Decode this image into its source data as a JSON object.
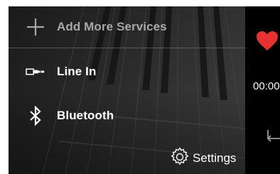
{
  "menu": {
    "add_services": {
      "label": "Add More Services",
      "icon": "plus-icon"
    },
    "line_in": {
      "label": "Line In",
      "icon": "line-in-jack-icon"
    },
    "bluetooth": {
      "label": "Bluetooth",
      "icon": "bluetooth-icon"
    },
    "settings": {
      "label": "Settings",
      "icon": "gear-icon"
    }
  },
  "player": {
    "time": "00:00",
    "favorite_icon": "heart-icon",
    "repeat_icon": "repeat-icon"
  },
  "colors": {
    "accent_heart": "#e8322f",
    "menu_bg": "#262626",
    "player_bg": "#000000",
    "dimmed_text": "#a8a8a8"
  }
}
